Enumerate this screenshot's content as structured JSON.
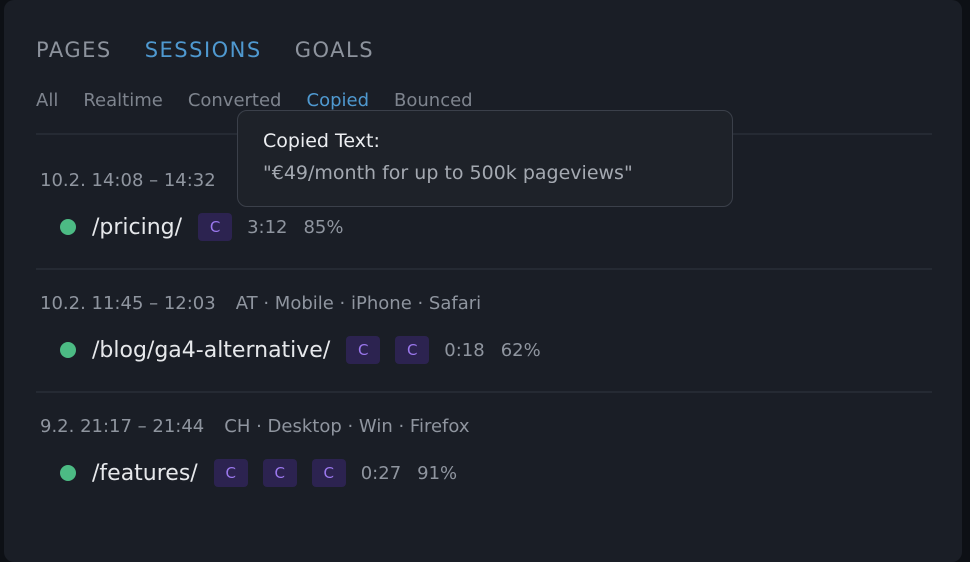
{
  "main_tabs": [
    {
      "label": "PAGES"
    },
    {
      "label": "SESSIONS"
    },
    {
      "label": "GOALS"
    }
  ],
  "sub_tabs": [
    {
      "label": "All"
    },
    {
      "label": "Realtime"
    },
    {
      "label": "Converted"
    },
    {
      "label": "Copied"
    },
    {
      "label": "Bounced"
    }
  ],
  "sessions": [
    {
      "time": "10.2. 14:08 – 14:32",
      "tech": "",
      "path": "/pricing/",
      "badge": "C",
      "duration": "3:12",
      "scroll": "85%"
    },
    {
      "time": "10.2. 11:45 – 12:03",
      "tech": "AT · Mobile · iPhone · Safari",
      "path": "/blog/ga4-alternative/",
      "badge": "C",
      "duration": "0:18",
      "scroll": "62%"
    },
    {
      "time": "9.2. 21:17 – 21:44",
      "tech": "CH · Desktop · Win · Firefox",
      "path": "/features/",
      "badge": "C",
      "duration": "0:27",
      "scroll": "91%"
    }
  ],
  "tooltip": {
    "title": "Copied Text:",
    "text": "\"€49/month for up to 500k pageviews\""
  },
  "colors": {
    "accent": "#4f99d0",
    "status_green": "#4cbb84",
    "badge_bg": "#2c2350",
    "badge_fg": "#9b78ee"
  }
}
